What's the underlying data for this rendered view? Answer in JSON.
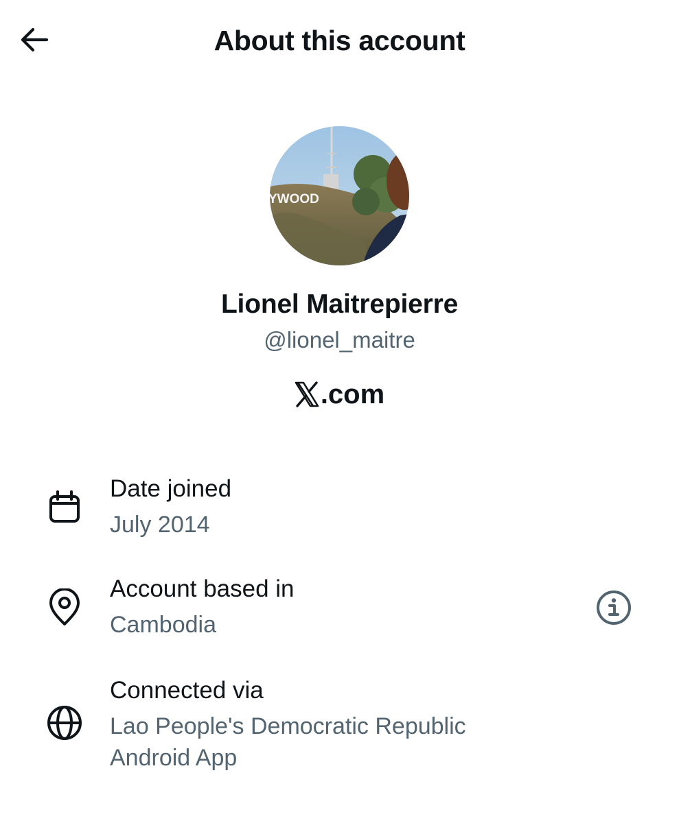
{
  "header": {
    "title": "About this account",
    "back_icon": "arrow-left-icon"
  },
  "profile": {
    "display_name": "Lionel Maitrepierre",
    "handle": "@lionel_maitre",
    "avatar_sign_text": "YWOOD",
    "platform_suffix": ".com"
  },
  "details": {
    "date_joined": {
      "icon": "calendar-icon",
      "label": "Date joined",
      "value": "July 2014"
    },
    "account_based_in": {
      "icon": "location-pin-icon",
      "label": "Account based in",
      "value": "Cambodia",
      "info_icon": "info-icon"
    },
    "connected_via": {
      "icon": "globe-icon",
      "label": "Connected via",
      "value_line1": "Lao People's Democratic Republic",
      "value_line2": "Android App"
    }
  },
  "colors": {
    "primary_text": "#0f1419",
    "secondary_text": "#536471",
    "background": "#ffffff"
  }
}
